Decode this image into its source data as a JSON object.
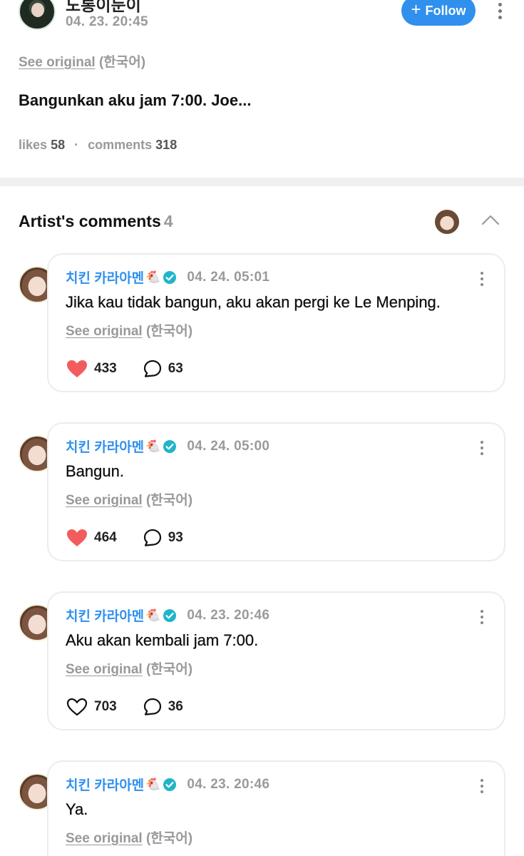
{
  "post": {
    "author_name": "도롱이둔이",
    "time": "04. 23. 20:45",
    "follow_label": "Follow",
    "see_original": "See original",
    "language": "(한국어)",
    "text": "Bangunkan aku jam 7:00. Joe...",
    "likes_label": "likes",
    "likes_count": "58",
    "separator": "·",
    "comments_label": "comments",
    "comments_count": "318"
  },
  "section": {
    "title": "Artist's comments",
    "count": "4"
  },
  "comments": [
    {
      "name": "치킨 카라아멘",
      "emoji": "🐔",
      "time": "04. 24. 05:01",
      "text": "Jika kau tidak bangun, aku akan pergi ke Le Menping.",
      "see_original": "See original",
      "language": "(한국어)",
      "likes": "433",
      "liked": true,
      "replies": "63"
    },
    {
      "name": "치킨 카라아멘",
      "emoji": "🐔",
      "time": "04. 24. 05:00",
      "text": "Bangun.",
      "see_original": "See original",
      "language": "(한국어)",
      "likes": "464",
      "liked": true,
      "replies": "93"
    },
    {
      "name": "치킨 카라아멘",
      "emoji": "🐔",
      "time": "04. 23. 20:46",
      "text": "Aku akan kembali jam 7:00.",
      "see_original": "See original",
      "language": "(한국어)",
      "likes": "703",
      "liked": false,
      "replies": "36"
    },
    {
      "name": "치킨 카라아멘",
      "emoji": "🐔",
      "time": "04. 23. 20:46",
      "text": "Ya.",
      "see_original": "See original",
      "language": "(한국어)"
    }
  ],
  "colors": {
    "accent": "#2f90ee",
    "liked_heart": "#f25c5c",
    "verified_badge": "#1fb5c9",
    "muted_text": "#999999"
  },
  "icons": [
    "overflow-menu-icon",
    "plus-icon",
    "chevron-up-icon",
    "verified-badge-icon",
    "heart-icon",
    "comment-bubble-icon"
  ]
}
